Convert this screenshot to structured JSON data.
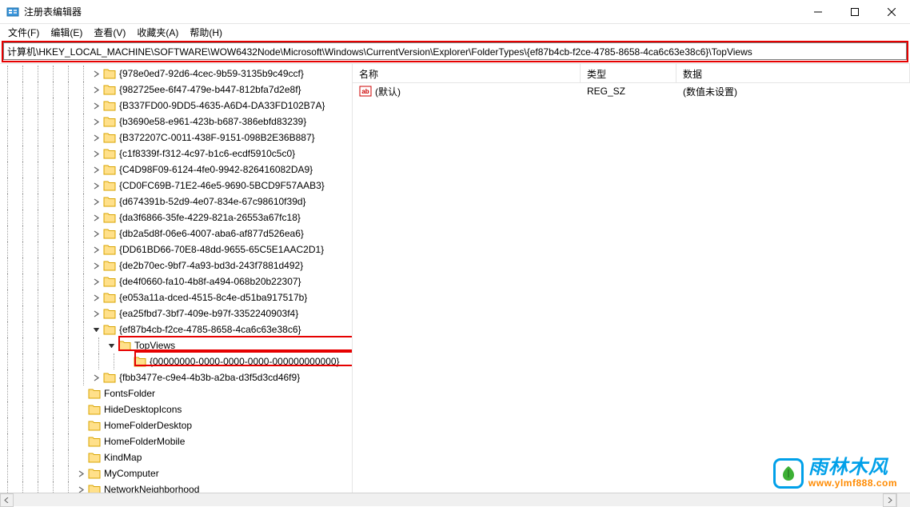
{
  "window": {
    "title": "注册表编辑器"
  },
  "menu": {
    "file": "文件(F)",
    "edit": "编辑(E)",
    "view": "查看(V)",
    "favorites": "收藏夹(A)",
    "help": "帮助(H)"
  },
  "address": "计算机\\HKEY_LOCAL_MACHINE\\SOFTWARE\\WOW6432Node\\Microsoft\\Windows\\CurrentVersion\\Explorer\\FolderTypes\\{ef87b4cb-f2ce-4785-8658-4ca6c63e38c6}\\TopViews",
  "tree": [
    {
      "depth": 6,
      "exp": "closed",
      "label": "{978e0ed7-92d6-4cec-9b59-3135b9c49ccf}"
    },
    {
      "depth": 6,
      "exp": "closed",
      "label": "{982725ee-6f47-479e-b447-812bfa7d2e8f}"
    },
    {
      "depth": 6,
      "exp": "closed",
      "label": "{B337FD00-9DD5-4635-A6D4-DA33FD102B7A}"
    },
    {
      "depth": 6,
      "exp": "closed",
      "label": "{b3690e58-e961-423b-b687-386ebfd83239}"
    },
    {
      "depth": 6,
      "exp": "closed",
      "label": "{B372207C-0011-438F-9151-098B2E36B887}"
    },
    {
      "depth": 6,
      "exp": "closed",
      "label": "{c1f8339f-f312-4c97-b1c6-ecdf5910c5c0}"
    },
    {
      "depth": 6,
      "exp": "closed",
      "label": "{C4D98F09-6124-4fe0-9942-826416082DA9}"
    },
    {
      "depth": 6,
      "exp": "closed",
      "label": "{CD0FC69B-71E2-46e5-9690-5BCD9F57AAB3}"
    },
    {
      "depth": 6,
      "exp": "closed",
      "label": "{d674391b-52d9-4e07-834e-67c98610f39d}"
    },
    {
      "depth": 6,
      "exp": "closed",
      "label": "{da3f6866-35fe-4229-821a-26553a67fc18}"
    },
    {
      "depth": 6,
      "exp": "closed",
      "label": "{db2a5d8f-06e6-4007-aba6-af877d526ea6}"
    },
    {
      "depth": 6,
      "exp": "closed",
      "label": "{DD61BD66-70E8-48dd-9655-65C5E1AAC2D1}"
    },
    {
      "depth": 6,
      "exp": "closed",
      "label": "{de2b70ec-9bf7-4a93-bd3d-243f7881d492}"
    },
    {
      "depth": 6,
      "exp": "closed",
      "label": "{de4f0660-fa10-4b8f-a494-068b20b22307}"
    },
    {
      "depth": 6,
      "exp": "closed",
      "label": "{e053a11a-dced-4515-8c4e-d51ba917517b}"
    },
    {
      "depth": 6,
      "exp": "closed",
      "label": "{ea25fbd7-3bf7-409e-b97f-3352240903f4}"
    },
    {
      "depth": 6,
      "exp": "open",
      "label": "{ef87b4cb-f2ce-4785-8658-4ca6c63e38c6}"
    },
    {
      "depth": 7,
      "exp": "open",
      "label": "TopViews"
    },
    {
      "depth": 8,
      "exp": "none",
      "label": "{00000000-0000-0000-0000-000000000000}"
    },
    {
      "depth": 6,
      "exp": "closed",
      "label": "{fbb3477e-c9e4-4b3b-a2ba-d3f5d3cd46f9}"
    },
    {
      "depth": 5,
      "exp": "none",
      "label": "FontsFolder"
    },
    {
      "depth": 5,
      "exp": "none",
      "label": "HideDesktopIcons"
    },
    {
      "depth": 5,
      "exp": "none",
      "label": "HomeFolderDesktop"
    },
    {
      "depth": 5,
      "exp": "none",
      "label": "HomeFolderMobile"
    },
    {
      "depth": 5,
      "exp": "none",
      "label": "KindMap"
    },
    {
      "depth": 5,
      "exp": "closed",
      "label": "MyComputer"
    },
    {
      "depth": 5,
      "exp": "closed",
      "label": "NetworkNeighborhood"
    }
  ],
  "list": {
    "columns": {
      "name": "名称",
      "type": "类型",
      "data": "数据"
    },
    "rows": [
      {
        "name": "(默认)",
        "type": "REG_SZ",
        "data": "(数值未设置)"
      }
    ]
  },
  "watermark": {
    "cn": "雨林木风",
    "url": "www.ylmf888.com"
  }
}
